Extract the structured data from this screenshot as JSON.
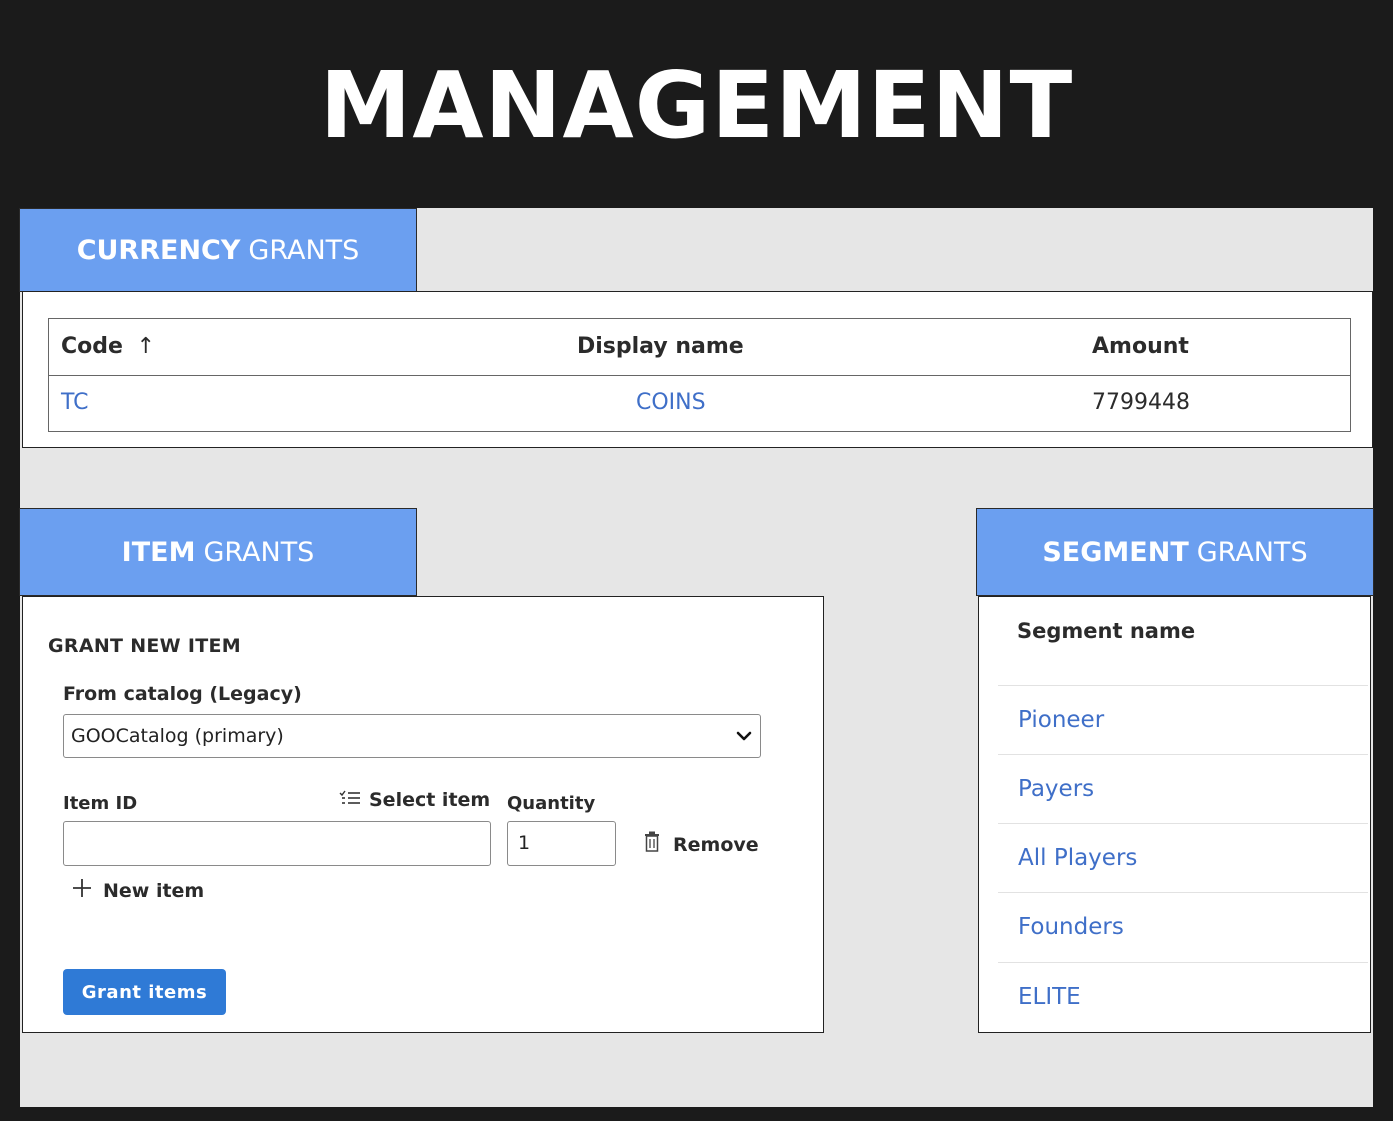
{
  "page": {
    "title": "MANAGEMENT"
  },
  "currency_grants": {
    "tab": {
      "bold": "CURRENCY",
      "rest": "GRANTS"
    },
    "columns": [
      "Code",
      "Display name",
      "Amount"
    ],
    "sort_indicator": "↑",
    "rows": [
      {
        "code": "TC",
        "display_name": "COINS",
        "amount": "7799448"
      }
    ]
  },
  "item_grants": {
    "tab": {
      "bold": "ITEM",
      "rest": "GRANTS"
    },
    "section_title": "GRANT NEW ITEM",
    "catalog_label": "From catalog (Legacy)",
    "catalog_value": "GOOCatalog (primary)",
    "item_id_label": "Item ID",
    "item_id_value": "",
    "select_item_label": "Select item",
    "quantity_label": "Quantity",
    "quantity_value": "1",
    "remove_label": "Remove",
    "new_item_label": "New item",
    "grant_button": "Grant items"
  },
  "segment_grants": {
    "tab": {
      "bold": "SEGMENT",
      "rest": "GRANTS"
    },
    "column": "Segment name",
    "segments": [
      "Pioneer",
      "Payers",
      "All Players",
      "Founders",
      "ELITE"
    ]
  }
}
